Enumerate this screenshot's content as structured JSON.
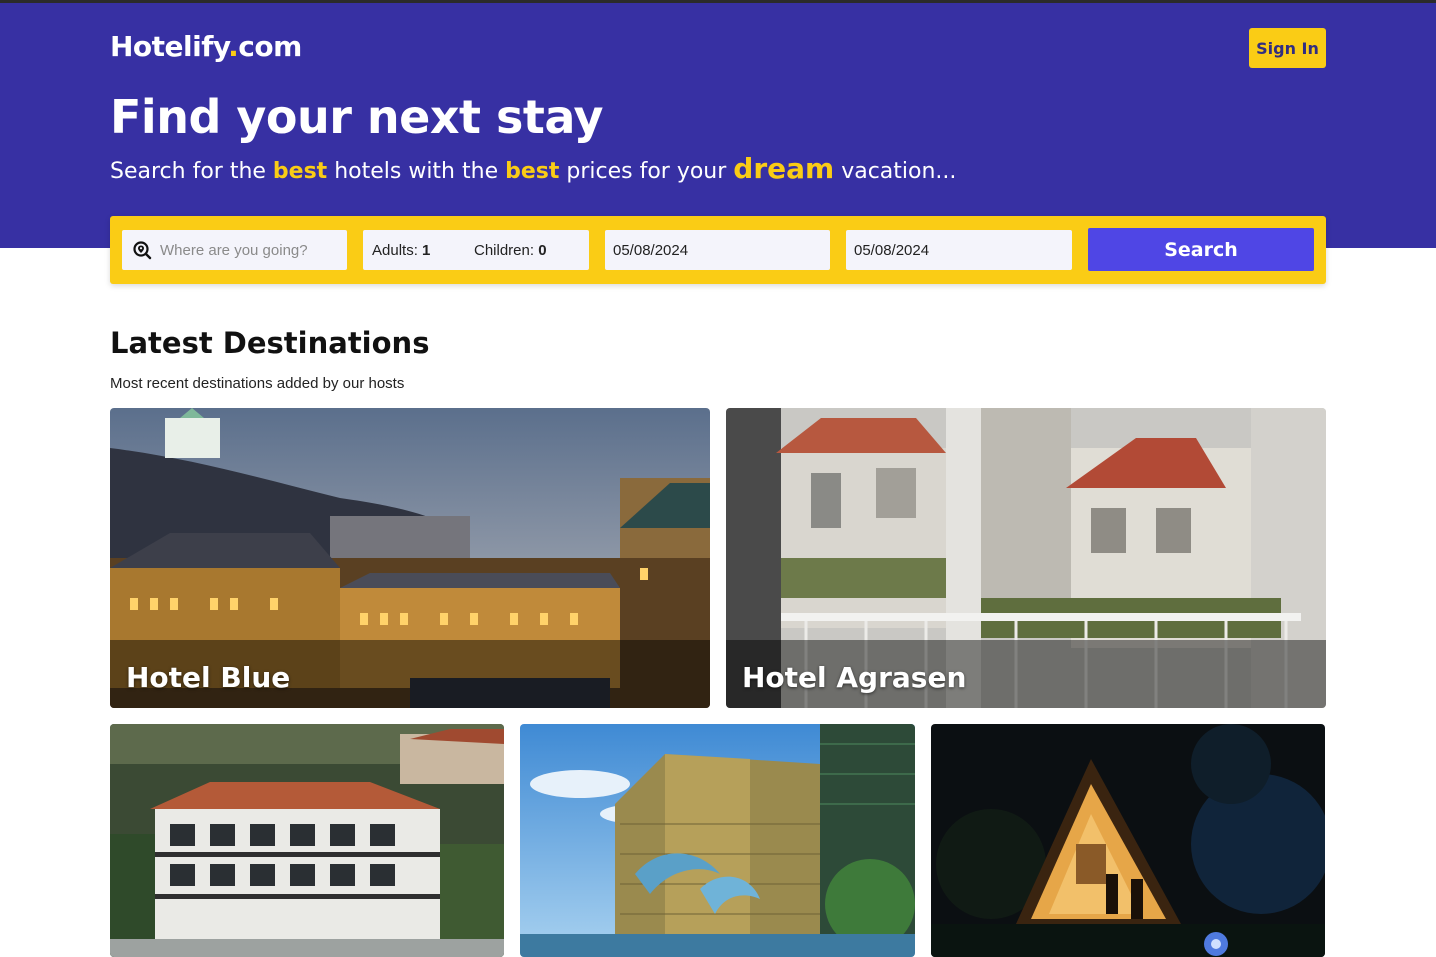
{
  "header": {
    "logo_main": "Hotelify",
    "logo_dot": ".",
    "logo_tld": "com",
    "signin_label": "Sign In"
  },
  "hero": {
    "headline": "Find your next stay",
    "tagline_1": "Search for the ",
    "tagline_hl_1": "best",
    "tagline_2": " hotels with the ",
    "tagline_hl_2": "best",
    "tagline_3": " prices for your ",
    "tagline_hl_3": "dream",
    "tagline_4": " vacation..."
  },
  "search": {
    "destination_placeholder": "Where are you going?",
    "destination_value": "",
    "adults_label": "Adults:",
    "adults_value": "1",
    "children_label": "Children:",
    "children_value": "0",
    "check_in": "05/08/2024",
    "check_out": "05/08/2024",
    "button_label": "Search"
  },
  "destinations": {
    "title": "Latest Destinations",
    "subtitle": "Most recent destinations added by our hosts",
    "cards": [
      {
        "name": "Hotel Blue"
      },
      {
        "name": "Hotel Agrasen"
      },
      {
        "name": ""
      },
      {
        "name": ""
      },
      {
        "name": ""
      }
    ]
  },
  "colors": {
    "brand_blue": "#3730a3",
    "accent_yellow": "#facc15",
    "button_indigo": "#4f46e5"
  }
}
